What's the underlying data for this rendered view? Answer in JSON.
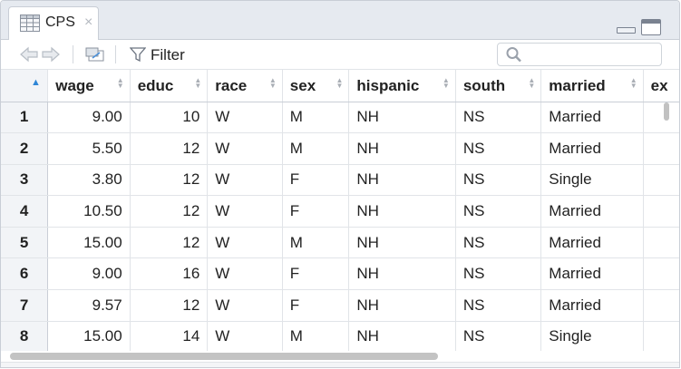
{
  "tab": {
    "label": "CPS",
    "close_glyph": "×",
    "icon": "table-grid-icon"
  },
  "toolbar": {
    "filter_label": "Filter",
    "search_placeholder": ""
  },
  "table": {
    "columns": [
      "wage",
      "educ",
      "race",
      "sex",
      "hispanic",
      "south",
      "married",
      "ex"
    ],
    "rows": [
      [
        "1",
        "9.00",
        "10",
        "W",
        "M",
        "NH",
        "NS",
        "Married"
      ],
      [
        "2",
        "5.50",
        "12",
        "W",
        "M",
        "NH",
        "NS",
        "Married"
      ],
      [
        "3",
        "3.80",
        "12",
        "W",
        "F",
        "NH",
        "NS",
        "Single"
      ],
      [
        "4",
        "10.50",
        "12",
        "W",
        "F",
        "NH",
        "NS",
        "Married"
      ],
      [
        "5",
        "15.00",
        "12",
        "W",
        "M",
        "NH",
        "NS",
        "Married"
      ],
      [
        "6",
        "9.00",
        "16",
        "W",
        "F",
        "NH",
        "NS",
        "Married"
      ],
      [
        "7",
        "9.57",
        "12",
        "W",
        "F",
        "NH",
        "NS",
        "Married"
      ],
      [
        "8",
        "15.00",
        "14",
        "W",
        "M",
        "NH",
        "NS",
        "Single"
      ]
    ]
  },
  "colors": {
    "accent": "#2f86d6",
    "header_bg": "#e6eaf0",
    "rownum_bg": "#f2f4f7",
    "border": "#c9ced6"
  }
}
